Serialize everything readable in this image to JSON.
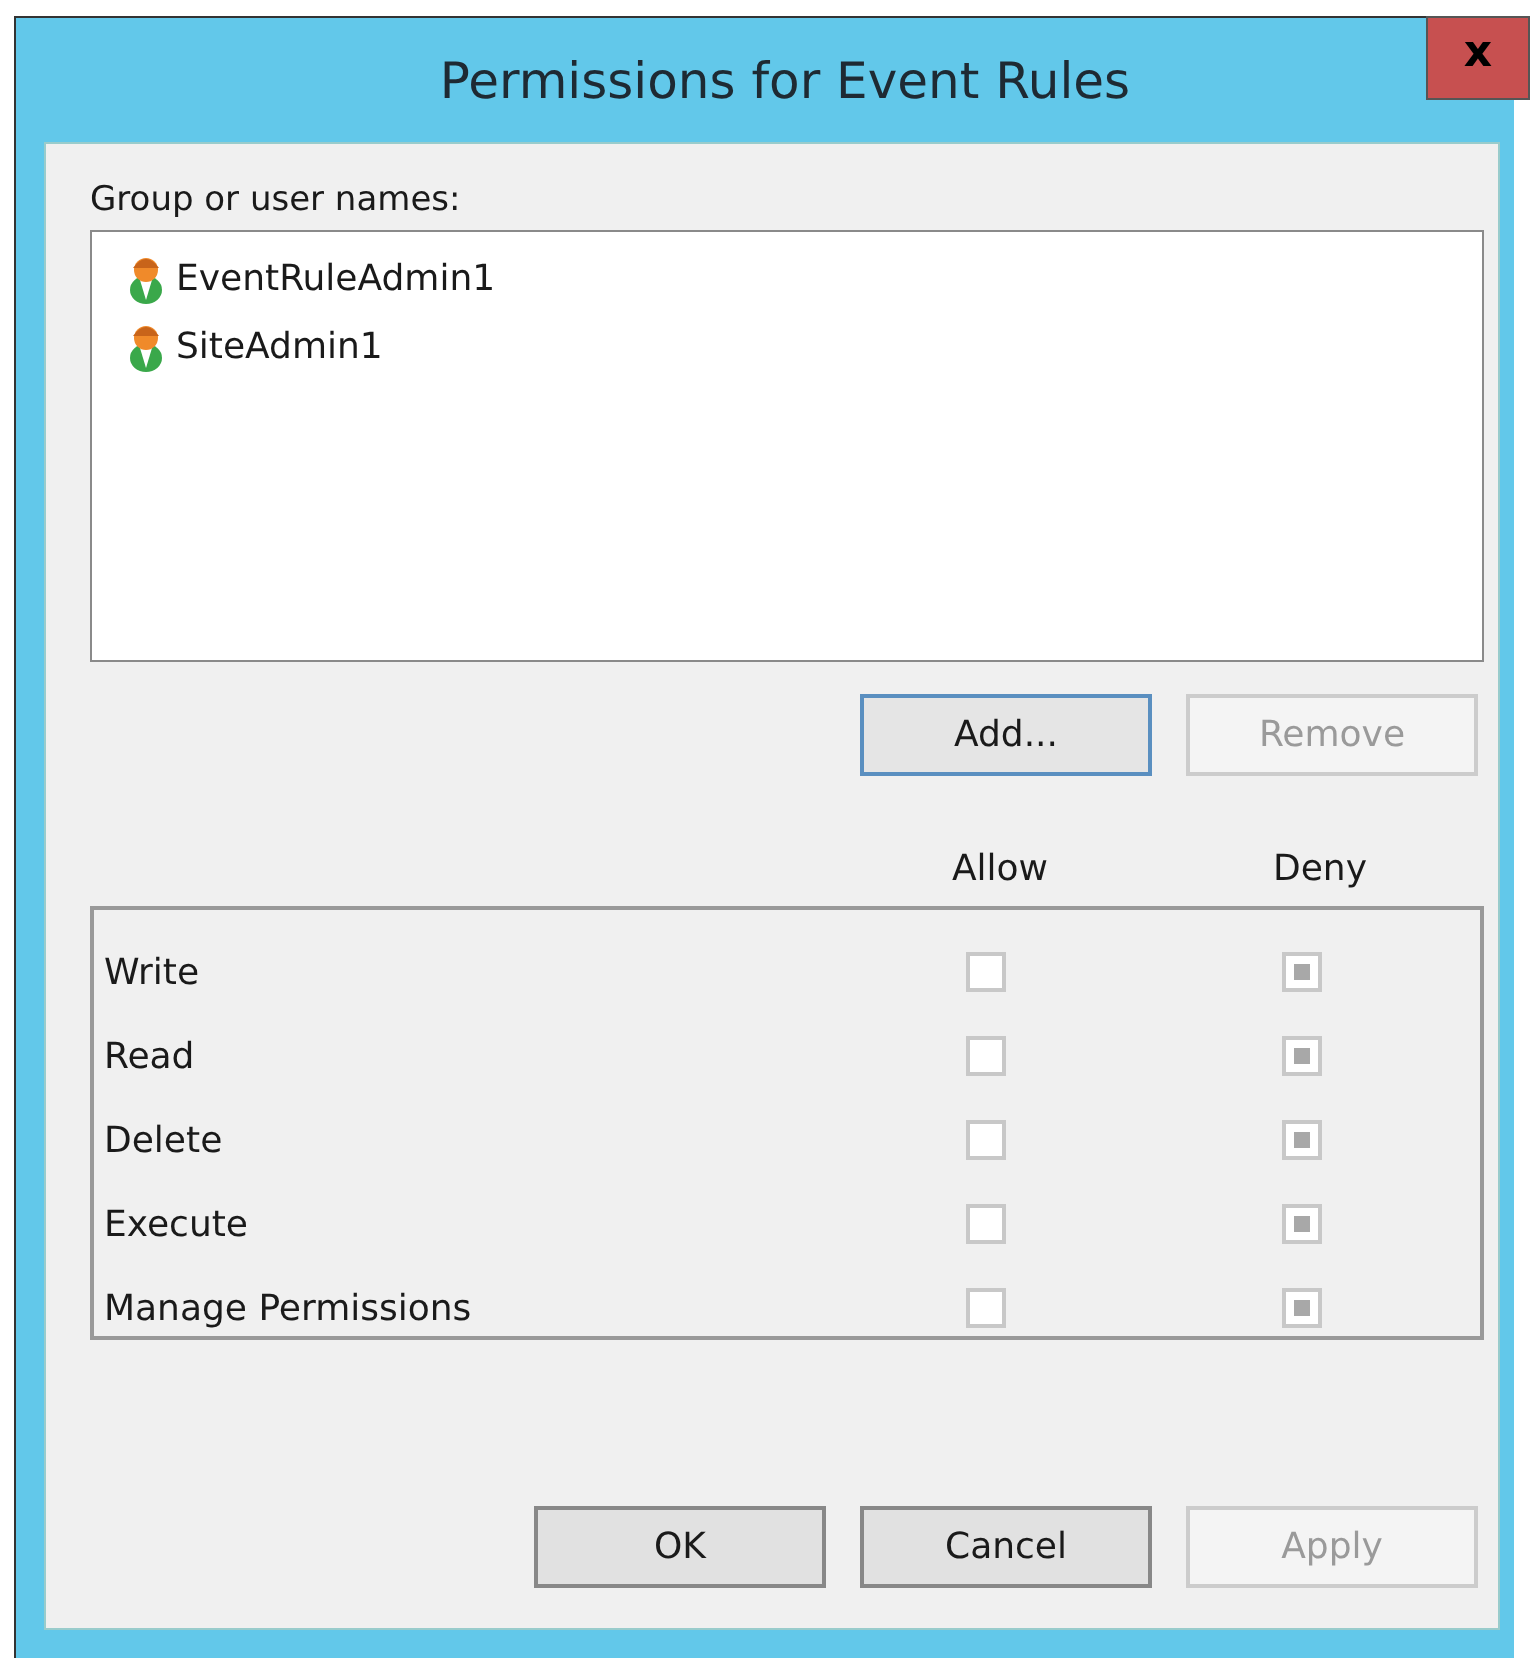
{
  "window": {
    "title": "Permissions for Event Rules",
    "close": "x"
  },
  "users": {
    "label": "Group or user names:",
    "items": [
      {
        "name": "EventRuleAdmin1",
        "selected": false
      },
      {
        "name": "SiteAdmin1",
        "selected": false
      }
    ]
  },
  "user_buttons": [
    {
      "label": "Add...",
      "disabled": false,
      "focused": true
    },
    {
      "label": "Remove",
      "disabled": true,
      "focused": false
    }
  ],
  "permissions": {
    "columns": [
      "Allow",
      "Deny"
    ],
    "rows": [
      {
        "name": "Write",
        "allow": false,
        "deny_mixed": true
      },
      {
        "name": "Read",
        "allow": false,
        "deny_mixed": true
      },
      {
        "name": "Delete",
        "allow": false,
        "deny_mixed": true
      },
      {
        "name": "Execute",
        "allow": false,
        "deny_mixed": true
      },
      {
        "name": "Manage Permissions",
        "allow": false,
        "deny_mixed": true
      }
    ]
  },
  "buttons": [
    {
      "label": "OK",
      "disabled": false
    },
    {
      "label": "Cancel",
      "disabled": false
    },
    {
      "label": "Apply",
      "disabled": true
    }
  ]
}
